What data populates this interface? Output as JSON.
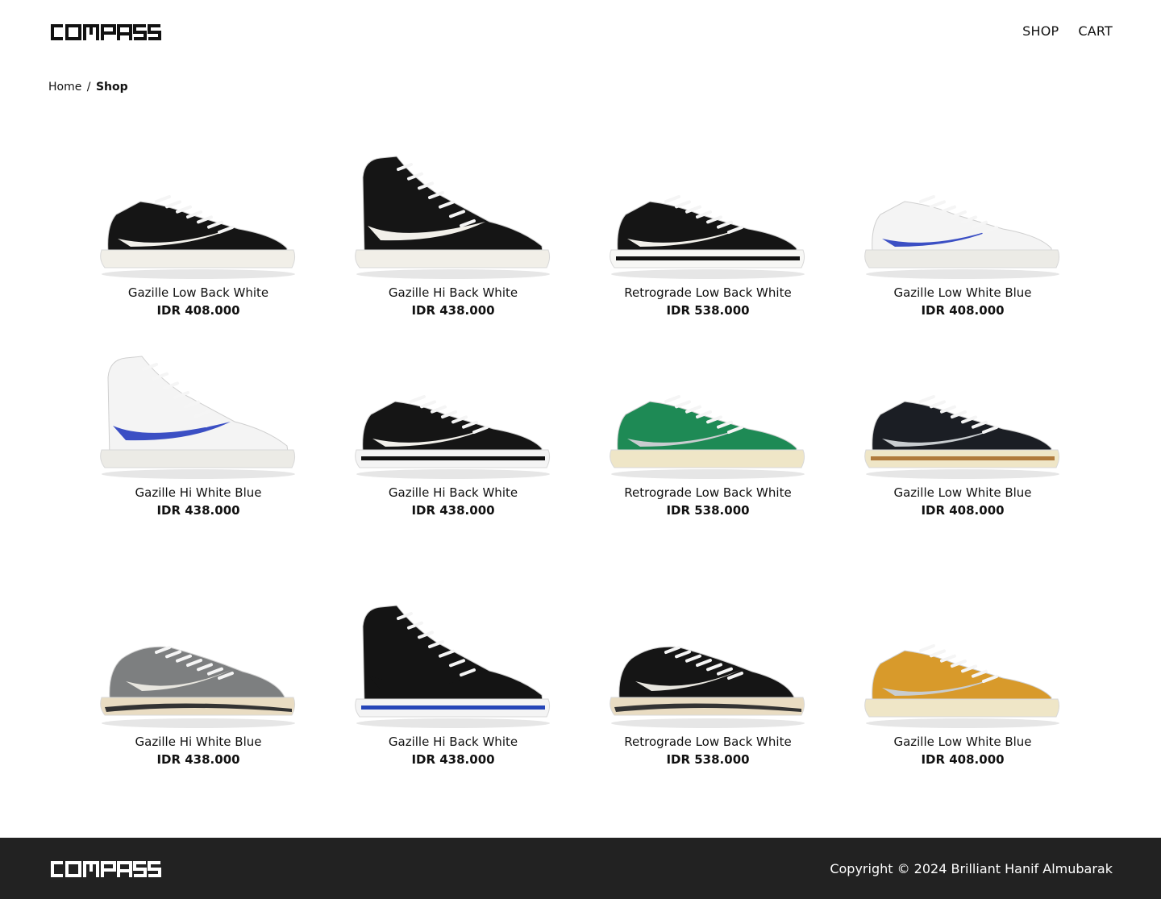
{
  "brand": {
    "name": "COMPASS"
  },
  "nav": {
    "shop": "SHOP",
    "cart": "CART"
  },
  "breadcrumb": {
    "home": "Home",
    "separator": "/",
    "current": "Shop"
  },
  "products": [
    {
      "name": "Gazille Low Back White",
      "price": "IDR 408.000",
      "upper": "#151515",
      "swoosh": "#f2f0ea",
      "sole": "#f1efe8",
      "stripe": "",
      "cut": "low"
    },
    {
      "name": "Gazille Hi Back White",
      "price": "IDR 438.000",
      "upper": "#151515",
      "swoosh": "#f2f0ea",
      "sole": "#f1efe8",
      "stripe": "",
      "cut": "hi"
    },
    {
      "name": "Retrograde Low Back White",
      "price": "IDR 538.000",
      "upper": "#151515",
      "swoosh": "#f2f0ea",
      "sole": "#f7f7f5",
      "stripe": "#111111",
      "cut": "low"
    },
    {
      "name": "Gazille Low White Blue",
      "price": "IDR 408.000",
      "upper": "#f4f4f4",
      "swoosh": "#3b4fc4",
      "sole": "#ecebe6",
      "stripe": "",
      "cut": "low"
    },
    {
      "name": "Gazille Hi White Blue",
      "price": "IDR 438.000",
      "upper": "#f4f4f4",
      "swoosh": "#3b4fc4",
      "sole": "#ecebe6",
      "stripe": "",
      "cut": "hi"
    },
    {
      "name": "Gazille Hi Back White",
      "price": "IDR 438.000",
      "upper": "#151515",
      "swoosh": "#f2f0ea",
      "sole": "#f4f4f4",
      "stripe": "#111111",
      "cut": "low"
    },
    {
      "name": "Retrograde Low Back White",
      "price": "IDR 538.000",
      "upper": "#1e8a55",
      "swoosh": "#c9cdd0",
      "sole": "#efe6c7",
      "stripe": "",
      "cut": "low"
    },
    {
      "name": "Gazille Low White Blue",
      "price": "IDR 408.000",
      "upper": "#1b1e24",
      "swoosh": "#c9cdd0",
      "sole": "#efe6c7",
      "stripe": "#b07a3c",
      "cut": "low"
    },
    {
      "name": "Gazille Hi White Blue",
      "price": "IDR 438.000",
      "upper": "#7d7f80",
      "swoosh": "#e8e6df",
      "sole": "#e9dcc2",
      "stripe": "#333333",
      "cut": "runner"
    },
    {
      "name": "Gazille Hi Back White",
      "price": "IDR 438.000",
      "upper": "#141414",
      "swoosh": "#141414",
      "sole": "#f4f4f4",
      "stripe": "#2646b8",
      "cut": "hi"
    },
    {
      "name": "Retrograde Low Back White",
      "price": "IDR 538.000",
      "upper": "#151515",
      "swoosh": "#e8e6df",
      "sole": "#e9dcc2",
      "stripe": "#333333",
      "cut": "runner"
    },
    {
      "name": "Gazille Low White Blue",
      "price": "IDR 408.000",
      "upper": "#d89a2b",
      "swoosh": "#c9cdd0",
      "sole": "#efe6c7",
      "stripe": "",
      "cut": "low"
    }
  ],
  "footer": {
    "copyright": "Copyright © 2024 Brilliant Hanif Almubarak"
  }
}
